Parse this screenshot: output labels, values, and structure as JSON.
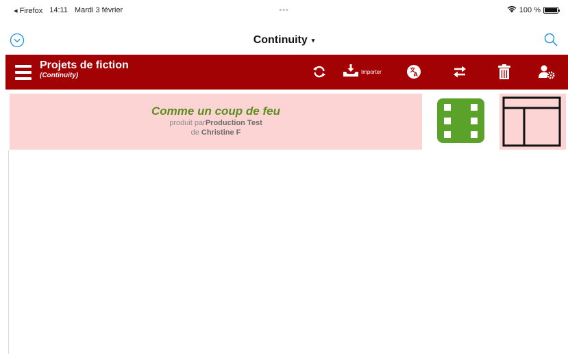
{
  "status_bar": {
    "back_app": "◂ Firefox",
    "time": "14:11",
    "date": "Mardi 3 février",
    "dots": "•••",
    "battery_text": "100 %"
  },
  "nav": {
    "title": "Continuity",
    "title_caret": "▾",
    "left_icon": "chevron-circle-down-icon",
    "right_icon": "search-icon"
  },
  "toolbar": {
    "title": "Projets de fiction",
    "subtitle": "(Continuity)",
    "importer_label": "Importer",
    "icons": [
      "menu-icon",
      "sync-icon",
      "import-icon",
      "translate-icon",
      "swap-icon",
      "trash-icon",
      "user-settings-icon"
    ]
  },
  "projects": [
    {
      "title": "Comme un coup de feu",
      "produced_prefix": "produit par",
      "production": "Production Test",
      "author_prefix": "de",
      "author": "Christine F"
    }
  ],
  "colors": {
    "accent": "#a30204",
    "row_bg": "#fcd4d4",
    "title_green": "#5c8d1f",
    "film_green": "#5aa22a",
    "ios_blue": "#1d8fe1"
  }
}
